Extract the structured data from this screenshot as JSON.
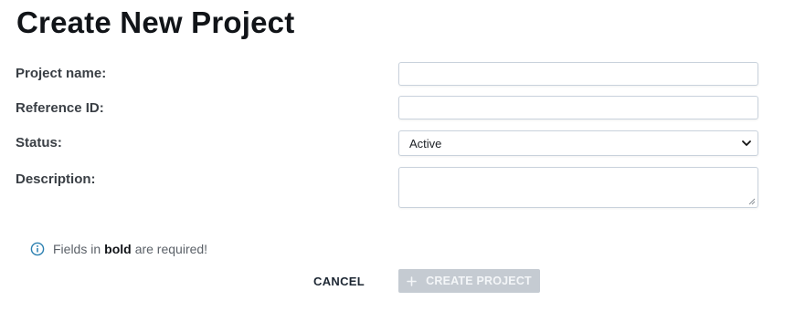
{
  "page": {
    "title": "Create New Project"
  },
  "form": {
    "project_name": {
      "label": "Project name:",
      "value": ""
    },
    "reference_id": {
      "label": "Reference ID:",
      "value": ""
    },
    "status": {
      "label": "Status:",
      "selected": "Active"
    },
    "description": {
      "label": "Description:",
      "value": ""
    }
  },
  "note": {
    "prefix": "Fields in",
    "bold_word": "bold",
    "suffix": "are required!",
    "icon": "info-icon"
  },
  "actions": {
    "cancel_label": "CANCEL",
    "create_label": "CREATE PROJECT",
    "create_icon": "plus-icon"
  },
  "colors": {
    "info_icon": "#2a7fb0",
    "disabled_button_bg": "#c5cbd2",
    "input_border": "#c9d2dc"
  }
}
